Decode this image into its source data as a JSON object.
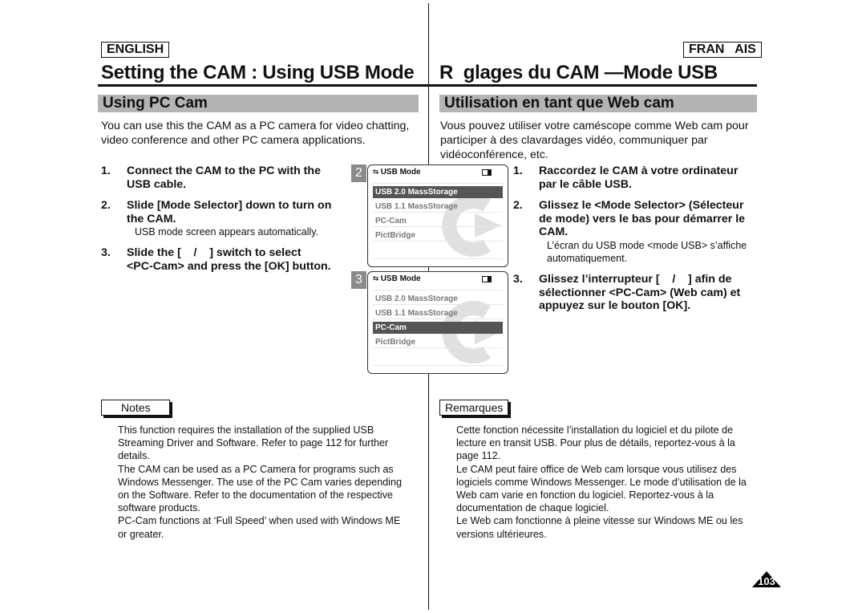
{
  "english": {
    "lang_tag": "ENGLISH",
    "title": "Setting the CAM : Using USB Mode",
    "section": "Using PC Cam",
    "intro": [
      "You can use this the CAM as a PC camera for video chatting,",
      "video conference and other PC camera applications."
    ],
    "steps": [
      {
        "num": "1.",
        "lines": [
          "Connect the CAM to the PC with the",
          "USB cable."
        ]
      },
      {
        "num": "2.",
        "lines": [
          "Slide [Mode Selector] down to turn on",
          "the CAM."
        ],
        "sub": "USB mode screen appears automatically."
      },
      {
        "num": "3.",
        "lines": [
          "Slide the [    /    ] switch to select",
          "<PC-Cam> and press the [OK] button."
        ]
      }
    ],
    "notes_label": "Notes",
    "notes": [
      "This function requires the installation of the supplied USB",
      "Streaming Driver and Software. Refer to page 112 for further",
      "details.",
      "The CAM can be used as a PC Camera for programs such as",
      "Windows Messenger. The use of the PC Cam varies depending",
      "on the Software. Refer to the documentation of the respective",
      "software products.",
      "PC-Cam functions at ‘Full Speed’ when used with Windows ME",
      "or greater."
    ]
  },
  "french": {
    "lang_tag": "FRAN   AIS",
    "title": "R  glages du CAM —Mode USB",
    "section": "Utilisation en tant que Web cam",
    "intro": [
      "Vous pouvez utiliser votre caméscope comme Web cam pour",
      "participer à des clavardages vidéo, communiquer par",
      "vidéoconférence, etc."
    ],
    "steps": [
      {
        "num": "1.",
        "lines": [
          "Raccordez le CAM à votre ordinateur",
          "par le câble USB."
        ]
      },
      {
        "num": "2.",
        "lines": [
          "Glissez le <Mode Selector> (Sélecteur",
          "de mode) vers le bas pour démarrer le",
          "CAM."
        ],
        "sub": [
          "L’écran du USB mode <mode USB> s’affiche",
          "automatiquement."
        ]
      },
      {
        "num": "3.",
        "lines": [
          "Glissez l’interrupteur [    /    ] afin de",
          "sélectionner <PC-Cam> (Web cam) et",
          "appuyez sur le bouton [OK]."
        ]
      }
    ],
    "notes_label": "Remarques",
    "notes": [
      "Cette fonction nécessite l’installation du logiciel et du pilote de",
      "lecture en transit USB. Pour plus de détails, reportez-vous à la",
      "page 112.",
      "Le CAM peut faire office de Web cam lorsque vous utilisez des",
      "logiciels comme Windows Messenger. Le mode d’utilisation de la",
      "Web cam varie en fonction du logiciel. Reportez-vous à la",
      "documentation de chaque logiciel.",
      "Le Web cam fonctionne à pleine vitesse sur Windows ME ou les",
      "versions ultérieures."
    ]
  },
  "screens": [
    {
      "badge": "2",
      "header": "USB Mode",
      "icon": "usb-icon",
      "battery_icon": "battery-icon",
      "items": [
        "USB 2.0 MassStorage",
        "USB 1.1 MassStorage",
        "PC-Cam",
        "PictBridge"
      ],
      "selected": 0
    },
    {
      "badge": "3",
      "header": "USB Mode",
      "icon": "usb-icon",
      "battery_icon": "battery-icon",
      "items": [
        "USB 2.0 MassStorage",
        "USB 1.1 MassStorage",
        "PC-Cam",
        "PictBridge"
      ],
      "selected": 2
    }
  ],
  "page_number": "103"
}
